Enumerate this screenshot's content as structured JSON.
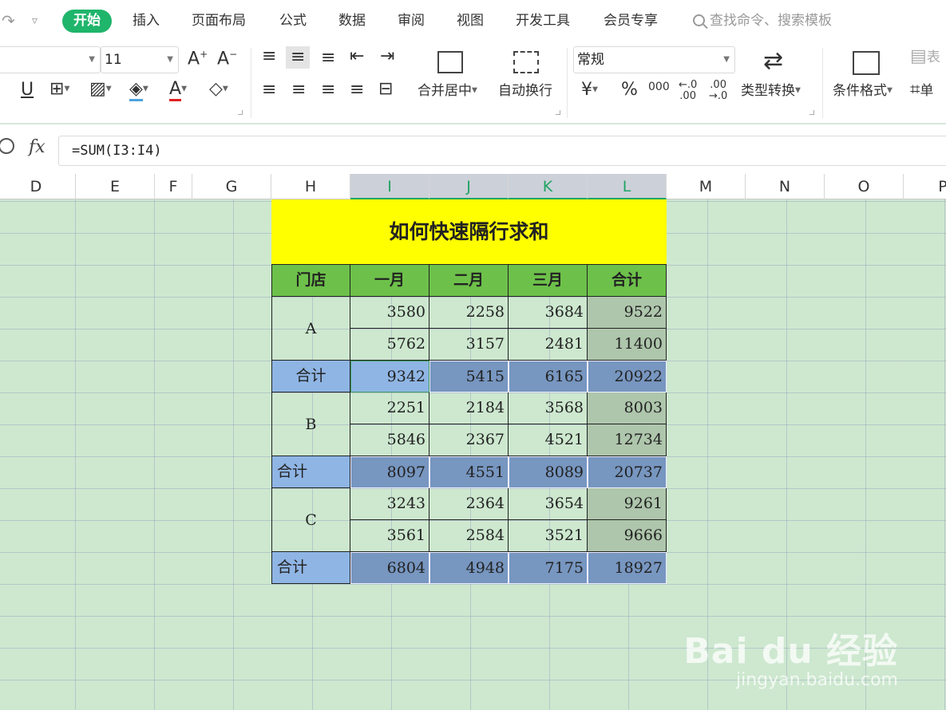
{
  "menubar": {
    "tabs": [
      "开始",
      "插入",
      "页面布局",
      "公式",
      "数据",
      "审阅",
      "视图",
      "开发工具",
      "会员专享"
    ],
    "search_placeholder": "查找命令、搜索模板"
  },
  "ribbon": {
    "font_size": "11",
    "number_format": "常规",
    "merge_center": "合并居中",
    "auto_wrap": "自动换行",
    "type_convert": "类型转换",
    "cond_format": "条件格式",
    "currency": "¥",
    "percent": "%",
    "thousands": "000",
    "table_label_partial": "表",
    "single_label_partial": "单"
  },
  "formula_bar": {
    "fx_label": "fx",
    "formula": "=SUM(I3:I4)"
  },
  "columns": [
    "D",
    "E",
    "F",
    "G",
    "H",
    "I",
    "J",
    "K",
    "L",
    "M",
    "N",
    "O",
    "P"
  ],
  "selected_columns": [
    "I",
    "J",
    "K",
    "L"
  ],
  "sheet": {
    "title": "如何快速隔行求和",
    "headers": [
      "门店",
      "一月",
      "二月",
      "三月",
      "合计"
    ],
    "groups": [
      {
        "store": "A",
        "rows": [
          [
            "3580",
            "2258",
            "3684",
            "9522"
          ],
          [
            "5762",
            "3157",
            "2481",
            "11400"
          ]
        ],
        "total_label": "合计",
        "total": [
          "9342",
          "5415",
          "6165",
          "20922"
        ]
      },
      {
        "store": "B",
        "rows": [
          [
            "2251",
            "2184",
            "3568",
            "8003"
          ],
          [
            "5846",
            "2367",
            "4521",
            "12734"
          ]
        ],
        "total_label": "合计",
        "total": [
          "8097",
          "4551",
          "8089",
          "20737"
        ]
      },
      {
        "store": "C",
        "rows": [
          [
            "3243",
            "2364",
            "3654",
            "9261"
          ],
          [
            "3561",
            "2584",
            "3521",
            "9666"
          ]
        ],
        "total_label": "合计",
        "total": [
          "6804",
          "4948",
          "7175",
          "18927"
        ]
      }
    ]
  },
  "watermark": {
    "logo": "Bai du 经验",
    "url": "jingyan.baidu.com"
  },
  "colors": {
    "accent_green": "#1fb56b",
    "sheet_bg": "#cde8cf",
    "title_yellow": "#ffff00",
    "header_green": "#6dc14a",
    "total_blue": "#7796c0"
  }
}
